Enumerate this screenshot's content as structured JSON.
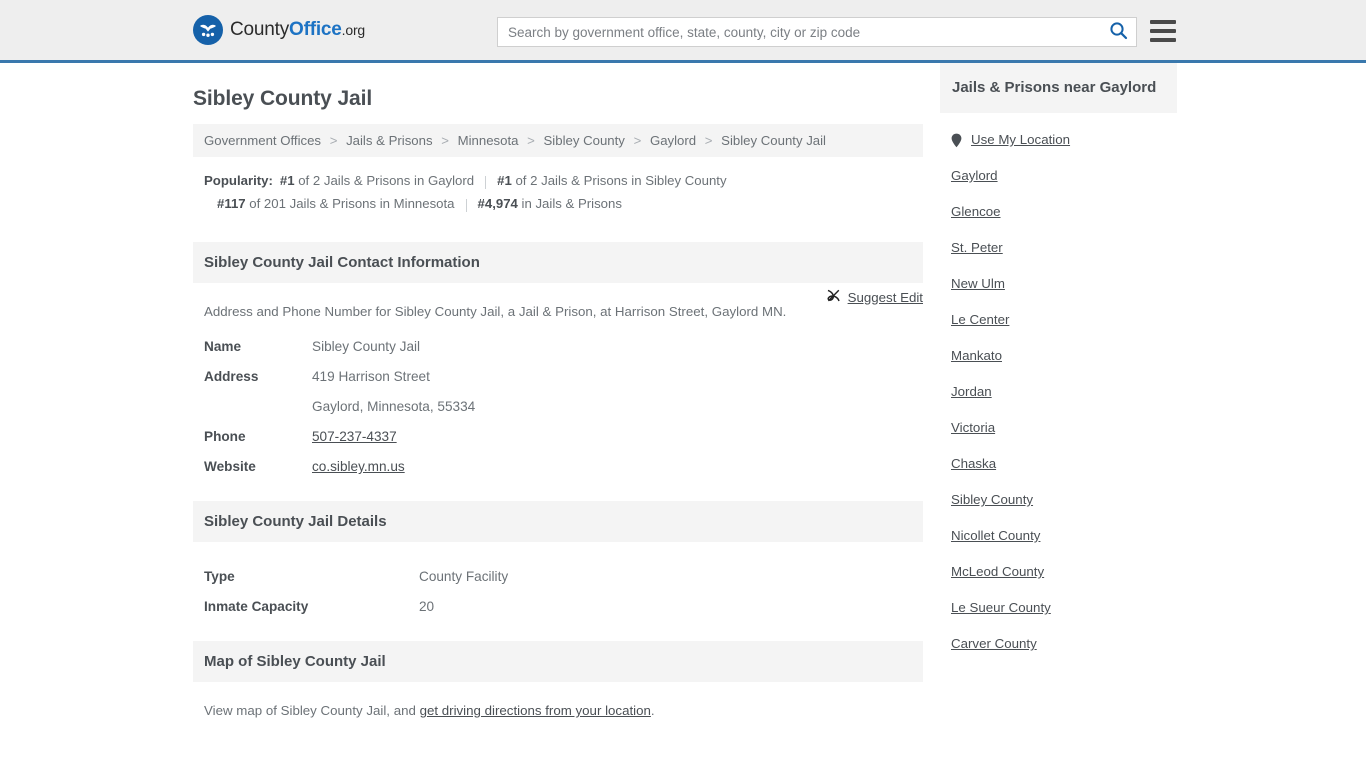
{
  "header": {
    "logo": {
      "part1": "County",
      "part2": "Office",
      "part3": ".org"
    },
    "search": {
      "placeholder": "Search by government office, state, county, city or zip code",
      "value": ""
    }
  },
  "page": {
    "title": "Sibley County Jail"
  },
  "breadcrumb": {
    "items": [
      "Government Offices",
      "Jails & Prisons",
      "Minnesota",
      "Sibley County",
      "Gaylord",
      "Sibley County Jail"
    ],
    "separator": ">"
  },
  "popularity": {
    "label": "Popularity:",
    "items": [
      {
        "rank": "#1",
        "rest": " of 2 Jails & Prisons in Gaylord"
      },
      {
        "rank": "#1",
        "rest": " of 2 Jails & Prisons in Sibley County"
      },
      {
        "rank": "#117",
        "rest": " of 201 Jails & Prisons in Minnesota"
      },
      {
        "rank": "#4,974",
        "rest": " in Jails & Prisons"
      }
    ]
  },
  "contact": {
    "heading": "Sibley County Jail Contact Information",
    "description": "Address and Phone Number for Sibley County Jail, a Jail & Prison, at Harrison Street, Gaylord MN.",
    "suggest_edit": "Suggest Edit",
    "rows": [
      {
        "key": "Name",
        "value": "Sibley County Jail"
      },
      {
        "key": "Address",
        "value": "419 Harrison Street"
      },
      {
        "key": "",
        "value": "Gaylord, Minnesota, 55334"
      },
      {
        "key": "Phone",
        "value": "507-237-4337"
      },
      {
        "key": "Website",
        "value": "co.sibley.mn.us"
      }
    ]
  },
  "details": {
    "heading": "Sibley County Jail Details",
    "rows": [
      {
        "key": "Type",
        "value": "County Facility"
      },
      {
        "key": "Inmate Capacity",
        "value": "20"
      }
    ]
  },
  "map": {
    "heading": "Map of Sibley County Jail",
    "text_before": "View map of Sibley County Jail, and ",
    "link": "get driving directions from your location",
    "text_after": "."
  },
  "sidebar": {
    "heading": "Jails & Prisons near Gaylord",
    "use_my_location": "Use My Location",
    "items": [
      "Gaylord",
      "Glencoe",
      "St. Peter",
      "New Ulm",
      "Le Center",
      "Mankato",
      "Jordan",
      "Victoria",
      "Chaska",
      "Sibley County",
      "Nicollet County",
      "McLeod County",
      "Le Sueur County",
      "Carver County"
    ]
  },
  "colors": {
    "brand_blue": "#1d73c4",
    "header_bg": "#eeeeee",
    "header_rule": "#3a78ad",
    "section_bg": "#f4f4f4",
    "text": "#4a4f54",
    "muted": "#6c7277"
  }
}
